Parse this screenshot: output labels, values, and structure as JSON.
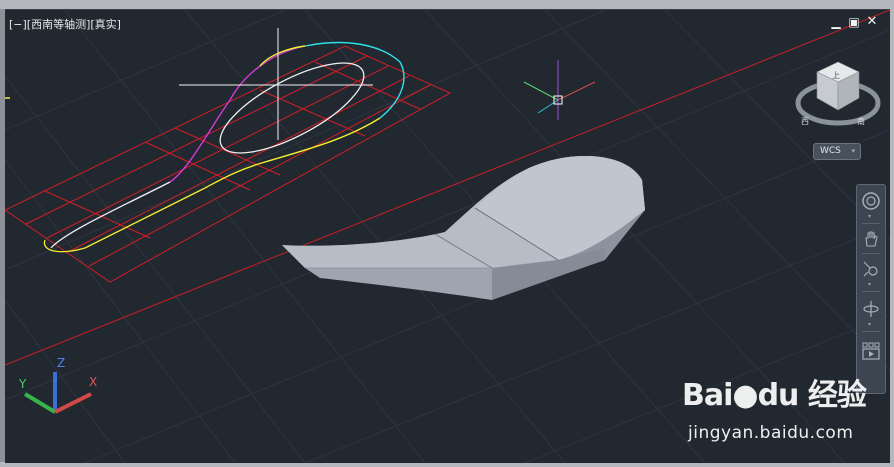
{
  "viewport": {
    "label": "[−][西南等轴测][真实]",
    "controls": {
      "minimize": "▁",
      "restore": "▣",
      "close": "✕"
    }
  },
  "viewcube": {
    "face_text": "上",
    "ring_labels": [
      "西",
      "南"
    ]
  },
  "wcs": {
    "label": "WCS",
    "arrow": "▾"
  },
  "navbar": {
    "tools": [
      "full-navigation-wheel",
      "pan",
      "zoom",
      "orbit",
      "showmotion"
    ]
  },
  "ucs": {
    "x_label": "X",
    "y_label": "Y",
    "z_label": "Z"
  },
  "watermark": {
    "logo": "Bai●du 经验",
    "url": "jingyan.baidu.com"
  },
  "colors": {
    "viewport_bg": "#212830",
    "grid": "#2f3843",
    "construction": "#d21e28",
    "solid": "#9aa1ae",
    "accent_yellow": "#f4ef2e",
    "accent_magenta": "#d43ad8",
    "accent_cyan": "#2fe0e8"
  }
}
